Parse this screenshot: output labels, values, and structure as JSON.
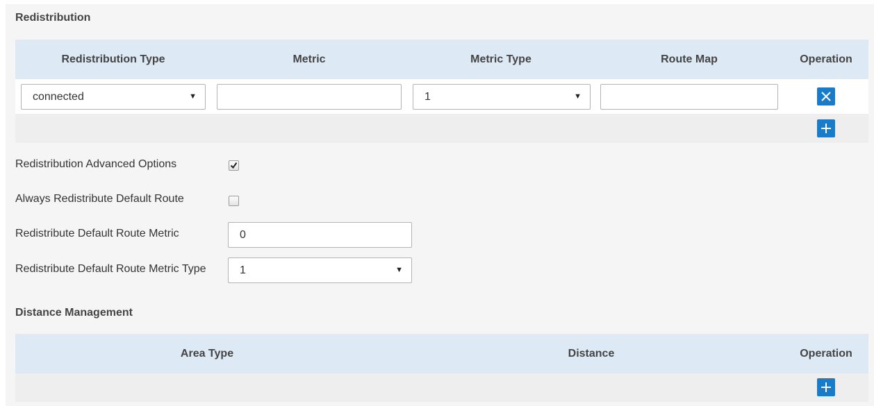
{
  "redistribution": {
    "title": "Redistribution",
    "columns": [
      "Redistribution Type",
      "Metric",
      "Metric Type",
      "Route Map",
      "Operation"
    ],
    "row": {
      "type": "connected",
      "metric": "",
      "metric_type": "1",
      "route_map": ""
    }
  },
  "options": {
    "advanced_label": "Redistribution Advanced Options",
    "advanced_checked": true,
    "always_default_label": "Always Redistribute Default Route",
    "always_default_checked": false,
    "default_metric_label": "Redistribute Default Route Metric",
    "default_metric_value": "0",
    "default_metric_type_label": "Redistribute Default Route Metric Type",
    "default_metric_type_value": "1"
  },
  "distance": {
    "title": "Distance Management",
    "columns": [
      "Area Type",
      "Distance",
      "Operation"
    ]
  },
  "colors": {
    "header_bg": "#dde9f5",
    "button_blue": "#1a7bc8",
    "panel_bg": "#f5f5f5"
  },
  "icons": [
    "delete-icon",
    "add-icon",
    "dropdown-arrow-icon",
    "checkmark-icon"
  ]
}
